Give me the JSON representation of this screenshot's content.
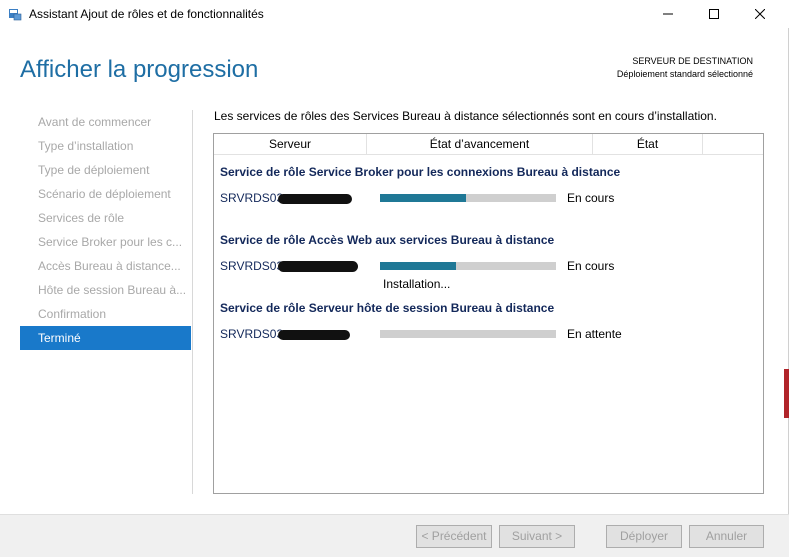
{
  "window": {
    "title": "Assistant Ajout de rôles et de fonctionnalités"
  },
  "header": {
    "page_title": "Afficher la progression",
    "destination_label": "SERVEUR DE DESTINATION",
    "destination_value": "Déploiement standard sélectionné"
  },
  "nav": {
    "items": [
      {
        "label": "Avant de commencer",
        "active": false
      },
      {
        "label": "Type d’installation",
        "active": false
      },
      {
        "label": "Type de déploiement",
        "active": false
      },
      {
        "label": "Scénario de déploiement",
        "active": false
      },
      {
        "label": "Services de rôle",
        "active": false
      },
      {
        "label": "Service Broker pour les c...",
        "active": false
      },
      {
        "label": "Accès Bureau à distance...",
        "active": false
      },
      {
        "label": "Hôte de session Bureau à...",
        "active": false
      },
      {
        "label": "Confirmation",
        "active": false
      },
      {
        "label": "Terminé",
        "active": true
      }
    ]
  },
  "content": {
    "intro": "Les services de rôles des Services Bureau à distance sélectionnés sont en cours d’installation.",
    "columns": [
      "Serveur",
      "État d’avancement",
      "État"
    ],
    "groups": [
      {
        "title": "Service de rôle Service Broker pour les connexions Bureau à distance",
        "server": "SRVRDS03.",
        "progress": 0.49,
        "status": "En cours",
        "substatus": ""
      },
      {
        "title": "Service de rôle Accès Web aux services Bureau à distance",
        "server": "SRVRDS03.",
        "progress": 0.43,
        "status": "En cours",
        "substatus": "Installation..."
      },
      {
        "title": "Service de rôle Serveur hôte de session Bureau à distance",
        "server": "SRVRDS03.",
        "progress": 0,
        "status": "En attente",
        "substatus": ""
      }
    ]
  },
  "footer": {
    "prev_label": "< Précédent",
    "next_label": "Suivant >",
    "deploy_label": "Déployer",
    "cancel_label": "Annuler"
  },
  "colors": {
    "title_blue": "#1e6ea4",
    "active_nav": "#1979ca",
    "progress_fill": "#1f7896",
    "group_title": "#13285a"
  }
}
